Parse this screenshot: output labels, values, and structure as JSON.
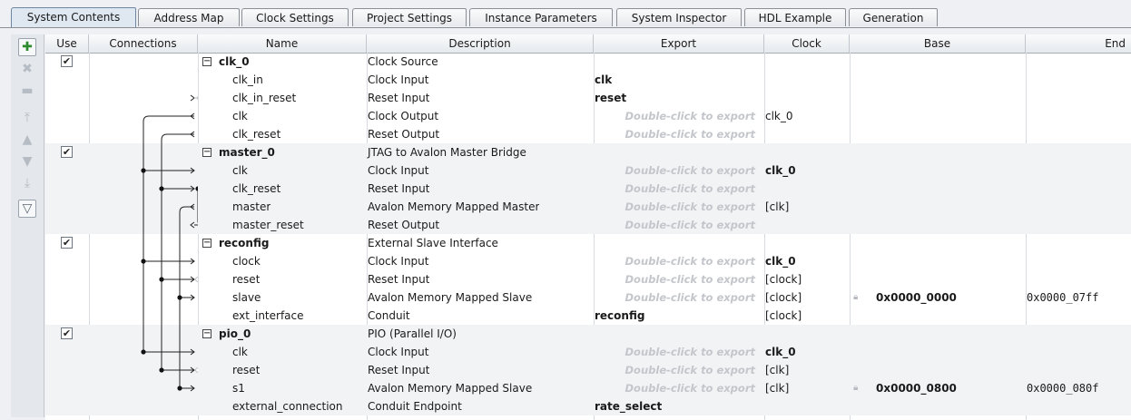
{
  "tabs": [
    {
      "label": "System Contents",
      "active": true
    },
    {
      "label": "Address Map",
      "active": false
    },
    {
      "label": "Clock Settings",
      "active": false
    },
    {
      "label": "Project Settings",
      "active": false
    },
    {
      "label": "Instance Parameters",
      "active": false
    },
    {
      "label": "System Inspector",
      "active": false
    },
    {
      "label": "HDL Example",
      "active": false
    },
    {
      "label": "Generation",
      "active": false
    }
  ],
  "toolbar": {
    "buttons": [
      {
        "icon": "add-icon",
        "glyph": "✚",
        "enabled": true
      },
      {
        "icon": "remove-icon",
        "glyph": "✖",
        "enabled": false
      },
      {
        "icon": "edit-icon",
        "glyph": "▬",
        "enabled": false
      },
      {
        "icon": "move-top-icon",
        "glyph": "⤒",
        "enabled": false
      },
      {
        "icon": "move-up-icon",
        "glyph": "▲",
        "enabled": false
      },
      {
        "icon": "move-down-icon",
        "glyph": "▼",
        "enabled": false
      },
      {
        "icon": "move-bottom-icon",
        "glyph": "⤓",
        "enabled": false
      },
      {
        "icon": "filter-icon",
        "glyph": "▽",
        "enabled": true
      }
    ]
  },
  "columns": {
    "use": "Use",
    "connections": "Connections",
    "name": "Name",
    "description": "Description",
    "export": "Export",
    "clock": "Clock",
    "base": "Base",
    "end": "End"
  },
  "export_hint": "Double-click to export",
  "rows": [
    {
      "kind": "parent",
      "use": true,
      "name": "clk_0",
      "description": "Clock Source",
      "export": "",
      "clock": "",
      "base": "",
      "end": ""
    },
    {
      "kind": "child",
      "name": "clk_in",
      "description": "Clock Input",
      "export": "clk",
      "clock": "",
      "base": "",
      "end": ""
    },
    {
      "kind": "child",
      "name": "clk_in_reset",
      "description": "Reset Input",
      "export": "reset",
      "clock": "",
      "base": "",
      "end": ""
    },
    {
      "kind": "child",
      "name": "clk",
      "description": "Clock Output",
      "export_hint": true,
      "clock": "clk_0",
      "base": "",
      "end": ""
    },
    {
      "kind": "child",
      "name": "clk_reset",
      "description": "Reset Output",
      "export_hint": true,
      "clock": "",
      "base": "",
      "end": ""
    },
    {
      "kind": "parent",
      "use": true,
      "name": "master_0",
      "description": "JTAG to Avalon Master Bridge",
      "export": "",
      "clock": "",
      "base": "",
      "end": ""
    },
    {
      "kind": "child",
      "name": "clk",
      "description": "Clock Input",
      "export_hint": true,
      "clock": "clk_0",
      "clock_bold": true,
      "base": "",
      "end": ""
    },
    {
      "kind": "child",
      "name": "clk_reset",
      "description": "Reset Input",
      "export_hint": true,
      "clock": "",
      "base": "",
      "end": ""
    },
    {
      "kind": "child",
      "name": "master",
      "description": "Avalon Memory Mapped Master",
      "export_hint": true,
      "clock": "[clk]",
      "base": "",
      "end": ""
    },
    {
      "kind": "child",
      "name": "master_reset",
      "description": "Reset Output",
      "export_hint": true,
      "clock": "",
      "base": "",
      "end": ""
    },
    {
      "kind": "parent",
      "use": true,
      "name": "reconfig",
      "description": "External Slave Interface",
      "export": "",
      "clock": "",
      "base": "",
      "end": ""
    },
    {
      "kind": "child",
      "name": "clock",
      "description": "Clock Input",
      "export_hint": true,
      "clock": "clk_0",
      "clock_bold": true,
      "base": "",
      "end": ""
    },
    {
      "kind": "child",
      "name": "reset",
      "description": "Reset Input",
      "export_hint": true,
      "clock": "[clock]",
      "base": "",
      "end": ""
    },
    {
      "kind": "child",
      "name": "slave",
      "description": "Avalon Memory Mapped Slave",
      "export_hint": true,
      "clock": "[clock]",
      "base": "0x0000_0000",
      "end": "0x0000_07ff",
      "lock": true
    },
    {
      "kind": "child",
      "name": "ext_interface",
      "description": "Conduit",
      "export": "reconfig",
      "clock": "[clock]",
      "base": "",
      "end": ""
    },
    {
      "kind": "parent",
      "use": true,
      "name": "pio_0",
      "description": "PIO (Parallel I/O)",
      "export": "",
      "clock": "",
      "base": "",
      "end": ""
    },
    {
      "kind": "child",
      "name": "clk",
      "description": "Clock Input",
      "export_hint": true,
      "clock": "clk_0",
      "clock_bold": true,
      "base": "",
      "end": ""
    },
    {
      "kind": "child",
      "name": "reset",
      "description": "Reset Input",
      "export_hint": true,
      "clock": "[clk]",
      "base": "",
      "end": ""
    },
    {
      "kind": "child",
      "name": "s1",
      "description": "Avalon Memory Mapped Slave",
      "export_hint": true,
      "clock": "[clk]",
      "base": "0x0000_0800",
      "end": "0x0000_080f",
      "lock": true
    },
    {
      "kind": "child",
      "name": "external_connection",
      "description": "Conduit Endpoint",
      "export": "rate_select",
      "clock": "",
      "base": "",
      "end": ""
    }
  ]
}
